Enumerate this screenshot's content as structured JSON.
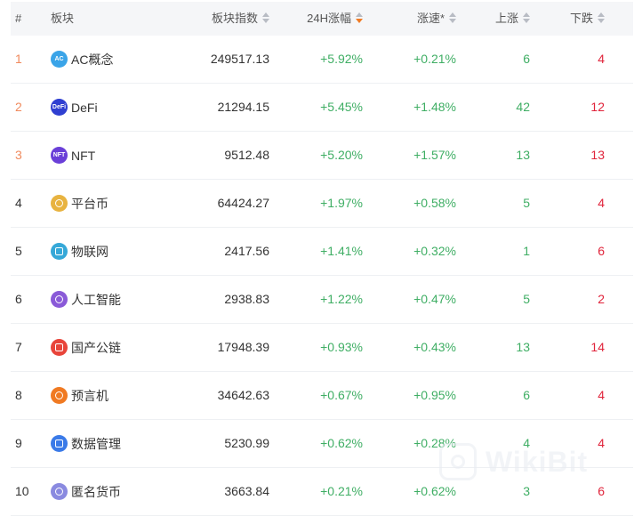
{
  "columns": {
    "rank": "#",
    "name": "板块",
    "index": "板块指数",
    "change_24h": "24H涨幅",
    "speed": "涨速*",
    "up": "上涨",
    "down": "下跌"
  },
  "sort": {
    "active_column": "change_24h",
    "direction": "descending",
    "active_color": "#f07a22"
  },
  "colors": {
    "positive": "#3fae64",
    "negative": "#e0233a",
    "top_rank": "#f08a5d"
  },
  "rows": [
    {
      "rank": "1",
      "icon": "ac-icon",
      "icon_text": "AC",
      "icon_color": "#3aa4e8",
      "name": "AC概念",
      "index": "249517.13",
      "change_24h": "+5.92%",
      "speed": "+0.21%",
      "up": "6",
      "down": "4"
    },
    {
      "rank": "2",
      "icon": "defi-icon",
      "icon_text": "DeFi",
      "icon_color": "#2f3fd1",
      "name": "DeFi",
      "index": "21294.15",
      "change_24h": "+5.45%",
      "speed": "+1.48%",
      "up": "42",
      "down": "12"
    },
    {
      "rank": "3",
      "icon": "nft-icon",
      "icon_text": "NFT",
      "icon_color": "#6a3fd8",
      "name": "NFT",
      "index": "9512.48",
      "change_24h": "+5.20%",
      "speed": "+1.57%",
      "up": "13",
      "down": "13"
    },
    {
      "rank": "4",
      "icon": "platform-coin-icon",
      "icon_text": "",
      "icon_color": "#e8b340",
      "name": "平台币",
      "index": "64424.27",
      "change_24h": "+1.97%",
      "speed": "+0.58%",
      "up": "5",
      "down": "4"
    },
    {
      "rank": "5",
      "icon": "iot-icon",
      "icon_text": "",
      "icon_color": "#35a8d8",
      "name": "物联网",
      "index": "2417.56",
      "change_24h": "+1.41%",
      "speed": "+0.32%",
      "up": "1",
      "down": "6"
    },
    {
      "rank": "6",
      "icon": "ai-robot-icon",
      "icon_text": "",
      "icon_color": "#8a5ad8",
      "name": "人工智能",
      "index": "2938.83",
      "change_24h": "+1.22%",
      "speed": "+0.47%",
      "up": "5",
      "down": "2"
    },
    {
      "rank": "7",
      "icon": "public-chain-icon",
      "icon_text": "",
      "icon_color": "#e8443a",
      "name": "国产公链",
      "index": "17948.39",
      "change_24h": "+0.93%",
      "speed": "+0.43%",
      "up": "13",
      "down": "14"
    },
    {
      "rank": "8",
      "icon": "oracle-icon",
      "icon_text": "",
      "icon_color": "#f07a22",
      "name": "预言机",
      "index": "34642.63",
      "change_24h": "+0.67%",
      "speed": "+0.95%",
      "up": "6",
      "down": "4"
    },
    {
      "rank": "9",
      "icon": "data-storage-icon",
      "icon_text": "",
      "icon_color": "#3a7ae8",
      "name": "数据管理",
      "index": "5230.99",
      "change_24h": "+0.62%",
      "speed": "+0.28%",
      "up": "4",
      "down": "4"
    },
    {
      "rank": "10",
      "icon": "privacy-coin-icon",
      "icon_text": "",
      "icon_color": "#8a8ae0",
      "name": "匿名货币",
      "index": "3663.84",
      "change_24h": "+0.21%",
      "speed": "+0.62%",
      "up": "3",
      "down": "6"
    }
  ],
  "watermark": {
    "text": "WikiBit"
  }
}
